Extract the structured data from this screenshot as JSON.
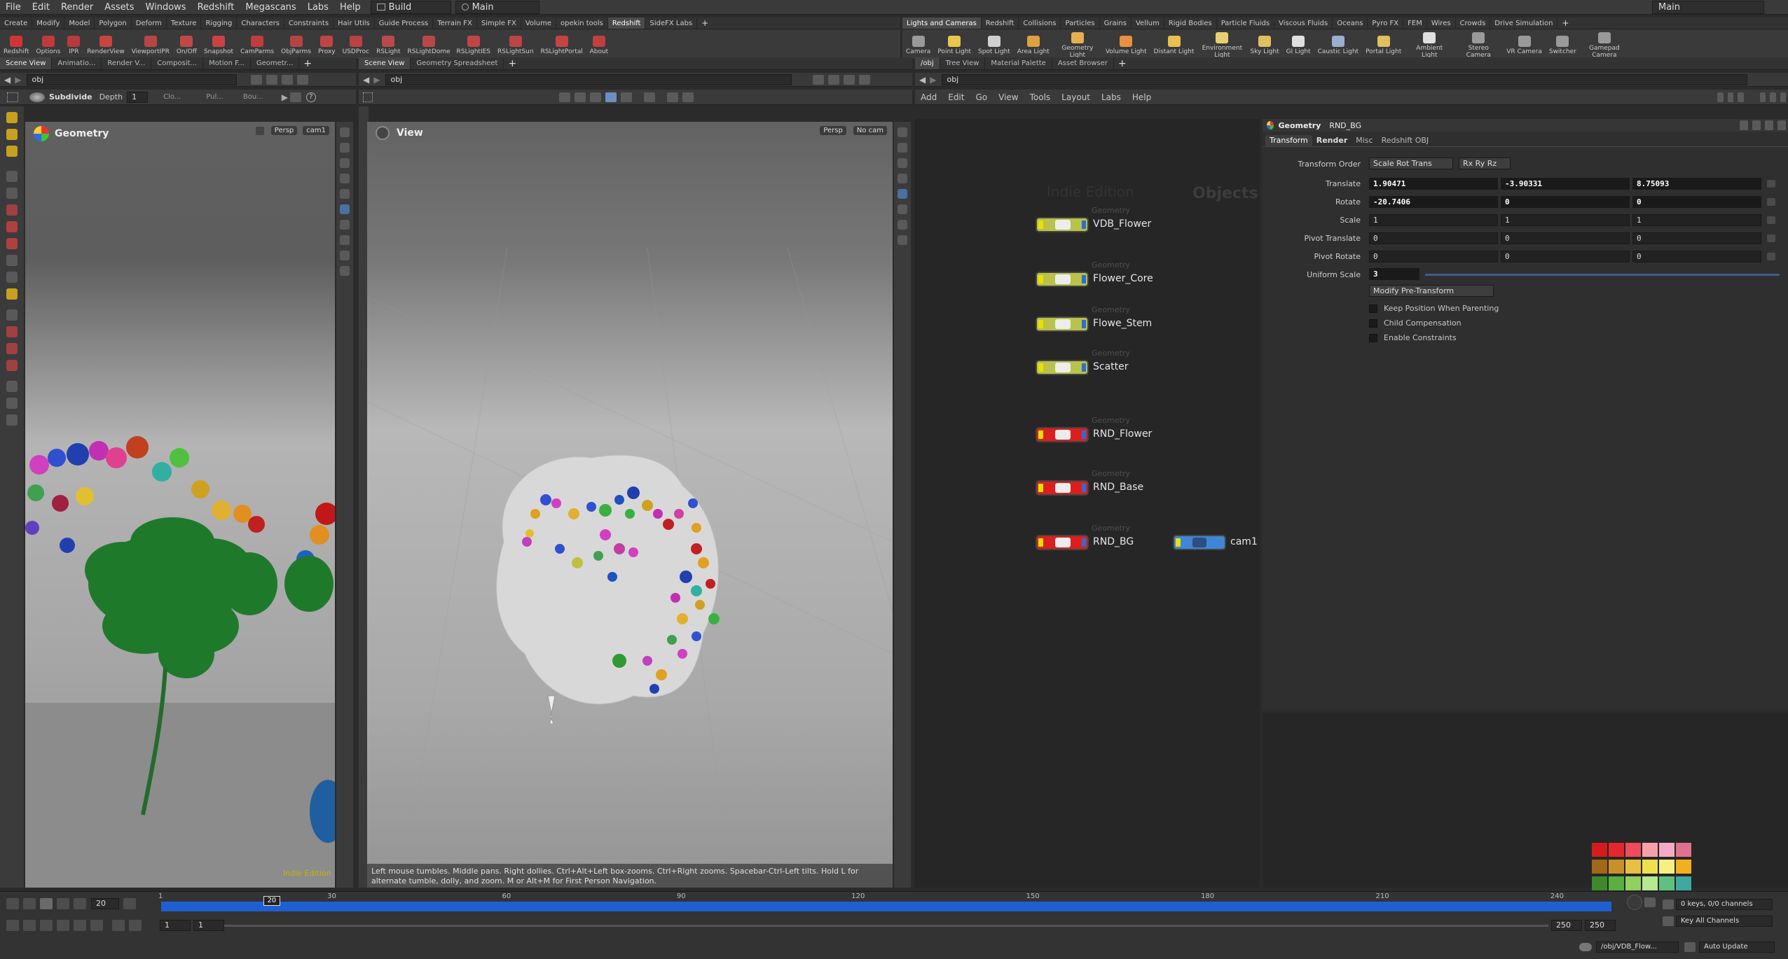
{
  "menubar": {
    "items": [
      "File",
      "Edit",
      "Render",
      "Assets",
      "Windows",
      "Redshift",
      "Megascans",
      "Labs",
      "Help"
    ],
    "desktop_value": "Build",
    "network_value": "Main",
    "right_desktop": "Main"
  },
  "shelf_left": {
    "tabs": [
      "Create",
      "Modify",
      "Model",
      "Polygon",
      "Deform",
      "Texture",
      "Rigging",
      "Characters",
      "Constraints",
      "Hair Utils",
      "Guide Process",
      "Terrain FX",
      "Simple FX",
      "Volume",
      "opekin tools",
      "Redshift",
      "SideFX Labs"
    ],
    "active_tab": "Redshift",
    "tools": [
      "Redshift",
      "Options",
      "IPR",
      "RenderView",
      "ViewportIPR",
      "On/Off",
      "Snapshot",
      "CamParms",
      "ObjParms",
      "Proxy",
      "USDProc",
      "RSLight",
      "RSLightDome",
      "RSLightIES",
      "RSLightSun",
      "RSLightPortal",
      "About"
    ],
    "tool_colors": [
      "#d03535",
      "#c03a3a",
      "#b83a3a",
      "#c7443f",
      "#b84545",
      "#c04848",
      "#c94242",
      "#c03d3d",
      "#b74444",
      "#c04444",
      "#b94242",
      "#bb4949",
      "#b94747",
      "#c04545",
      "#bd4444",
      "#c44343",
      "#c04040"
    ]
  },
  "shelf_right": {
    "tabs": [
      "Lights and Cameras",
      "Redshift",
      "Collisions",
      "Particles",
      "Grains",
      "Vellum",
      "Rigid Bodies",
      "Particle Fluids",
      "Viscous Fluids",
      "Oceans",
      "Pyro FX",
      "FEM",
      "Wires",
      "Crowds",
      "Drive Simulation"
    ],
    "active_tab": "Lights and Cameras",
    "tools": [
      "Camera",
      "Point Light",
      "Spot Light",
      "Area Light",
      "Geometry Light",
      "Volume Light",
      "Distant Light",
      "Environment Light",
      "Sky Light",
      "GI Light",
      "Caustic Light",
      "Portal Light",
      "Ambient Light",
      "Stereo Camera",
      "VR Camera",
      "Switcher",
      "Gamepad Camera"
    ],
    "tool_colors": [
      "#9a9a9a",
      "#e8c84a",
      "#d0d0d0",
      "#e0a040",
      "#e8b050",
      "#e89040",
      "#e8c050",
      "#e8d070",
      "#e0c060",
      "#e0e0e0",
      "#9ab0d0",
      "#e0c060",
      "#e0e0e0",
      "#9a9a9a",
      "#9a9a9a",
      "#9a9a9a",
      "#9a9a9a"
    ]
  },
  "left_pane": {
    "tabs": [
      "Scene View",
      "Animatio...",
      "Render V...",
      "Composit...",
      "Motion F...",
      "Geometr..."
    ],
    "path": "obj",
    "subdivide_label": "Subdivide",
    "depth_label": "Depth",
    "depth_value": "1",
    "clo_label": "Clo...",
    "pul_label": "Pul...",
    "bou_label": "Bou...",
    "title": "Geometry",
    "persp_menu": "Persp",
    "cam_menu": "cam1",
    "watermark": "Indie Edition"
  },
  "mid_pane": {
    "tabs": [
      "Scene View",
      "Geometry Spreadsheet"
    ],
    "path": "obj",
    "title": "View",
    "persp_menu": "Persp",
    "cam_menu": "No cam",
    "hint": "Left mouse tumbles. Middle pans. Right dollies. Ctrl+Alt+Left box-zooms. Ctrl+Right zooms. Spacebar-Ctrl-Left tilts. Hold L for alternate tumble, dolly, and zoom. M or Alt+M for First Person Navigation."
  },
  "right_pane": {
    "tabs": [
      "/obj",
      "Tree View",
      "Material Palette",
      "Asset Browser"
    ],
    "path": "obj",
    "menu": [
      "Add",
      "Edit",
      "Go",
      "View",
      "Tools",
      "Layout",
      "Labs",
      "Help"
    ],
    "watermark": "Indie Edition",
    "context_label": "Objects"
  },
  "nodes": [
    {
      "type": "Geometry",
      "name": "VDB_Flower",
      "color": "#b9c24a"
    },
    {
      "type": "Geometry",
      "name": "Flower_Core",
      "color": "#b9c24a"
    },
    {
      "type": "Geometry",
      "name": "Flowe_Stem",
      "color": "#b9c24a"
    },
    {
      "type": "Geometry",
      "name": "Scatter",
      "color": "#b9c24a"
    },
    {
      "type": "Geometry",
      "name": "RND_Flower",
      "color": "#dd1e1e"
    },
    {
      "type": "Geometry",
      "name": "RND_Base",
      "color": "#dd1e1e"
    },
    {
      "type": "Geometry",
      "name": "RND_BG",
      "color": "#dd1e1e"
    },
    {
      "type": "",
      "name": "cam1",
      "color": "#3f86d6"
    }
  ],
  "params": {
    "node_type": "Geometry",
    "node_name": "RND_BG",
    "tabs": [
      "Transform",
      "Render",
      "Misc",
      "Redshift OBJ"
    ],
    "active_tab": "Transform",
    "transform_order_label": "Transform Order",
    "transform_order": "Scale Rot Trans",
    "rot_order": "Rx Ry Rz",
    "rows": [
      {
        "label": "Translate",
        "values": [
          "1.90471",
          "-3.90331",
          "8.75093"
        ]
      },
      {
        "label": "Rotate",
        "values": [
          "-20.7406",
          "0",
          "0"
        ]
      },
      {
        "label": "Scale",
        "values": [
          "1",
          "1",
          "1"
        ]
      },
      {
        "label": "Pivot Translate",
        "values": [
          "0",
          "0",
          "0"
        ]
      },
      {
        "label": "Pivot Rotate",
        "values": [
          "0",
          "0",
          "0"
        ]
      }
    ],
    "uniform_scale_label": "Uniform Scale",
    "uniform_scale": "3",
    "pre_transform": "Modify Pre-Transform",
    "checkboxes": [
      "Keep Position When Parenting",
      "Child Compensation",
      "Enable Constraints"
    ]
  },
  "timeline": {
    "current_frame": "20",
    "playhead_frame": 20,
    "ticks": [
      "1",
      "30",
      "60",
      "90",
      "120",
      "150",
      "180",
      "210",
      "240"
    ],
    "tick_frames": [
      1,
      30,
      60,
      90,
      120,
      150,
      180,
      210,
      240
    ],
    "start_frame": "1",
    "start_frame_b": "1",
    "end_frame": "250",
    "end_frame_b": "250",
    "keys_info": "0 keys, 0/0 channels",
    "key_all": "Key All Channels",
    "status_path": "/obj/VDB_Flow...",
    "auto_update": "Auto Update"
  },
  "palette_colors": [
    "#d41c1c",
    "#e5262e",
    "#ef4b5a",
    "#f7a0a8",
    "#f5a8c8",
    "#e0708f",
    "#a06818",
    "#c8902a",
    "#e8c040",
    "#f0e050",
    "#f7f080",
    "#f0b020",
    "#3c8a2a",
    "#58b040",
    "#90d060",
    "#b8e890",
    "#60c080",
    "#40a8a0",
    "#2850a0",
    "#3870d0",
    "#5898f0",
    "#90c0f8",
    "#38a0e0",
    "#2878c0",
    "#6040a0",
    "#8060c8",
    "#a080e8",
    "#c0a0f0",
    "#d060d0",
    "#a040a0",
    "#000000",
    "#303030",
    "#606060",
    "#909090",
    "#c0c0c0",
    "#ffffff"
  ]
}
